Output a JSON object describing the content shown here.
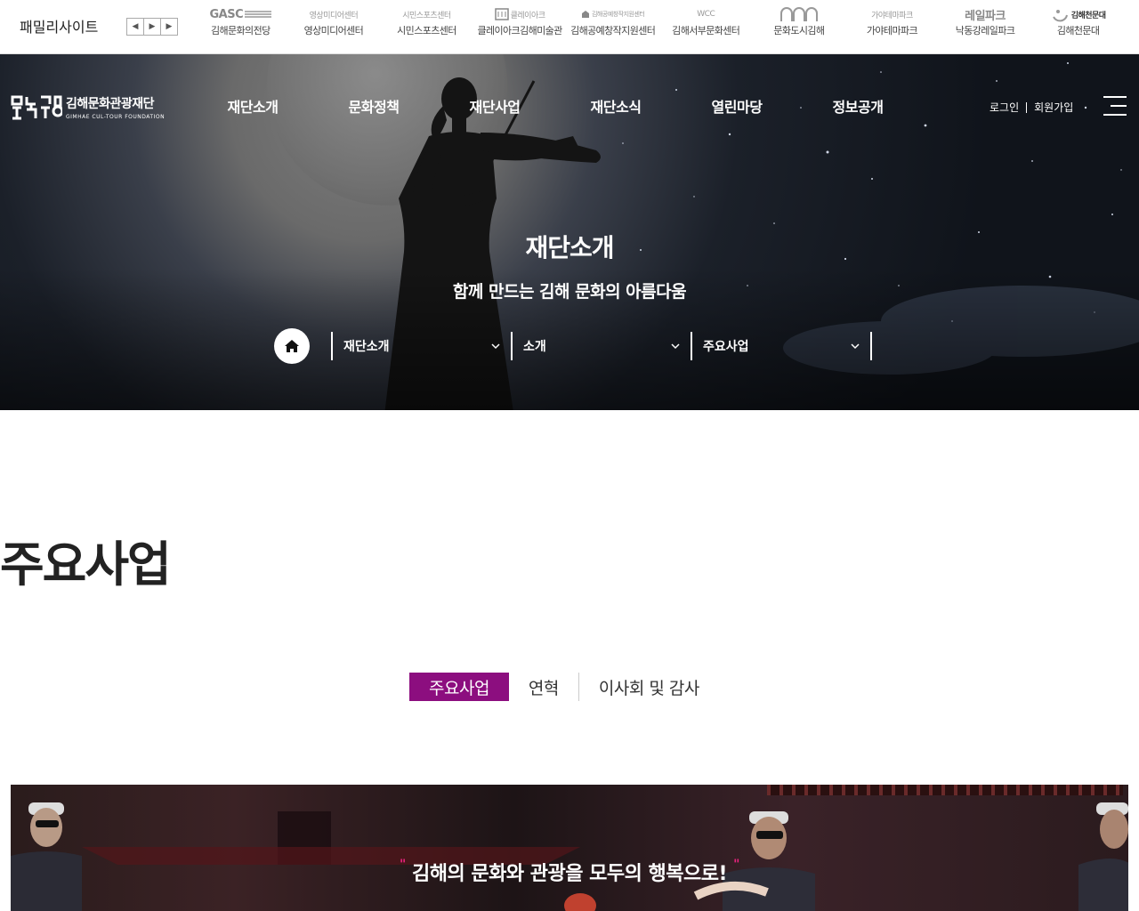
{
  "family": {
    "title": "패밀리사이트",
    "prev": "◀",
    "play": "▶",
    "next": "▶",
    "sites": [
      {
        "logo": "GASC",
        "name": "김해문화의전당"
      },
      {
        "logo": "영상미디어센터",
        "name": "영상미디어센터"
      },
      {
        "logo": "시민스포츠센터",
        "name": "시민스포츠센터"
      },
      {
        "logo": "클레이아크",
        "name": "클레이아크김해미술관"
      },
      {
        "logo": "김해공예창작지원센터",
        "name": "김해공예창작지원센터"
      },
      {
        "logo": "WCC",
        "name": "김해서부문화센터"
      },
      {
        "logo": "문화도시",
        "name": "문화도시김해"
      },
      {
        "logo": "가야테마파크",
        "name": "가야테마파크"
      },
      {
        "logo": "레일파크",
        "name": "낙동강레일파크"
      },
      {
        "logo": "김해천문대",
        "name": "김해천문대"
      }
    ]
  },
  "header": {
    "logo_name": "김해문화관광재단",
    "logo_sub": "GIMHAE CUL-TOUR FOUNDATION",
    "nav": [
      "재단소개",
      "문화정책",
      "재단사업",
      "재단소식",
      "열린마당",
      "정보공개"
    ],
    "login": "로그인",
    "signup": "회원가입"
  },
  "hero": {
    "title": "재단소개",
    "subtitle": "함께 만드는 김해 문화의 아름다움",
    "breadcrumb": [
      "재단소개",
      "소개",
      "주요사업"
    ]
  },
  "content": {
    "page_title": "주요사업",
    "tabs": [
      "주요사업",
      "연혁",
      "이사회 및 감사"
    ],
    "active_tab": 0,
    "banner_text": "김해의 문화와 관광을 모두의 행복으로!",
    "banner_quote_open": "\"",
    "banner_quote_close": "\""
  },
  "colors": {
    "accent": "#8c0e7f",
    "quote": "#e8227d"
  }
}
